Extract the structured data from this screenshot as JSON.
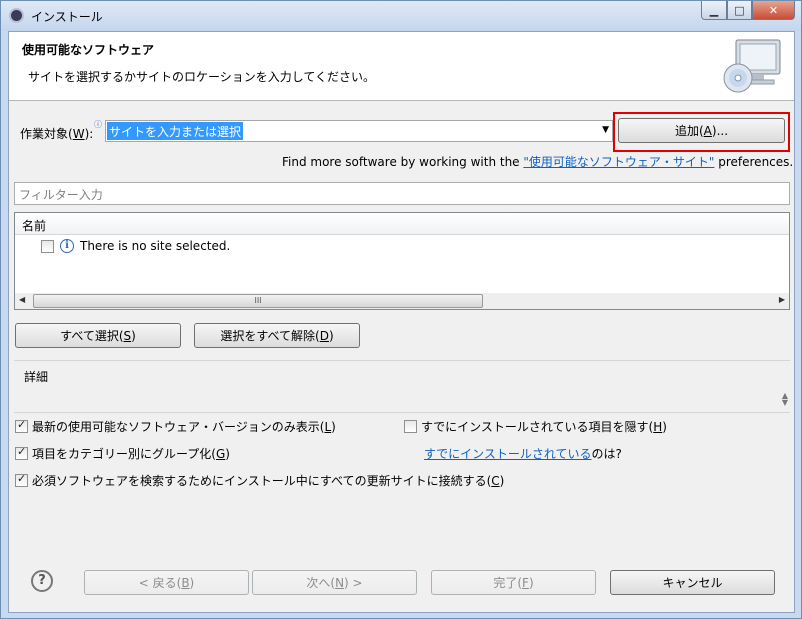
{
  "window": {
    "title": "インストール",
    "min_glyph": "▁",
    "max_glyph": "□",
    "close_glyph": "✕"
  },
  "header": {
    "title": "使用可能なソフトウェア",
    "description": "サイトを選択するかサイトのロケーションを入力してください。"
  },
  "work_with": {
    "label_prefix": "作業対象(",
    "label_mnemonic": "W",
    "label_suffix": "):",
    "value": "サイトを入力または選択",
    "add_button_prefix": "追加(",
    "add_button_mnemonic": "A",
    "add_button_suffix": ")..."
  },
  "find_more": {
    "prefix": "Find more software by working with the ",
    "link": "\"使用可能なソフトウェア・サイト\"",
    "suffix": " preferences."
  },
  "filter": {
    "placeholder": "フィルター入力"
  },
  "tree": {
    "column_header": "名前",
    "rows": [
      {
        "label": "There is no site selected.",
        "checked": false
      }
    ],
    "scroll_grip": "III"
  },
  "buttons": {
    "select_all_prefix": "すべて選択(",
    "select_all_mnemonic": "S",
    "select_all_suffix": ")",
    "deselect_all_prefix": "選択をすべて解除(",
    "deselect_all_mnemonic": "D",
    "deselect_all_suffix": ")"
  },
  "details": {
    "label": "詳細"
  },
  "options": {
    "latest_only": {
      "prefix": "最新の使用可能なソフトウェア・バージョンのみ表示(",
      "mnemonic": "L",
      "suffix": ")",
      "checked": true
    },
    "group_by_category": {
      "prefix": "項目をカテゴリー別にグループ化(",
      "mnemonic": "G",
      "suffix": ")",
      "checked": true
    },
    "contact_all_sites": {
      "prefix": "必須ソフトウェアを検索するためにインストール中にすべての更新サイトに接続する(",
      "mnemonic": "C",
      "suffix": ")",
      "checked": true
    },
    "hide_installed": {
      "prefix": "すでにインストールされている項目を隠す(",
      "mnemonic": "H",
      "suffix": ")",
      "checked": false
    },
    "already_installed_link": "すでにインストールされている",
    "already_installed_suffix": " のは?"
  },
  "footer": {
    "help_glyph": "?",
    "back_prefix": "< 戻る(",
    "back_mnemonic": "B",
    "back_suffix": ")",
    "next_prefix": "次へ(",
    "next_mnemonic": "N",
    "next_suffix": ") >",
    "finish_prefix": "完了(",
    "finish_mnemonic": "F",
    "finish_suffix": ")",
    "cancel": "キャンセル"
  }
}
